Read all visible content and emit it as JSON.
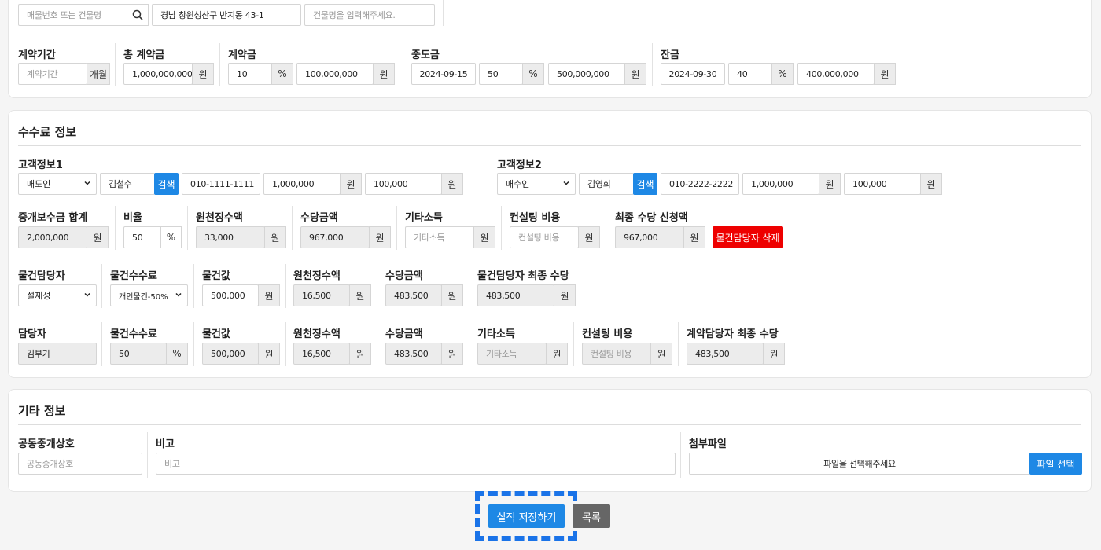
{
  "top": {
    "search_placeholder": "매물번호 또는 건물명",
    "address": "경남 창원성산구 반지동 43-1",
    "building_placeholder": "건물명을 입력해주세요."
  },
  "contract": {
    "period": {
      "label": "계약기간",
      "placeholder": "계약기간",
      "suffix": "개월"
    },
    "total": {
      "label": "총 계약금",
      "value": "1,000,000,000",
      "suffix": "원"
    },
    "deposit": {
      "label": "계약금",
      "percent": "10",
      "pct_suffix": "%",
      "amount": "100,000,000",
      "suffix": "원"
    },
    "middle": {
      "label": "중도금",
      "date": "2024-09-15",
      "percent": "50",
      "pct_suffix": "%",
      "amount": "500,000,000",
      "suffix": "원"
    },
    "balance": {
      "label": "잔금",
      "date": "2024-09-30",
      "percent": "40",
      "pct_suffix": "%",
      "amount": "400,000,000",
      "suffix": "원"
    }
  },
  "fee": {
    "title": "수수료 정보",
    "customer1": {
      "label": "고객정보1",
      "type": "매도인",
      "name": "김철수",
      "search": "검색",
      "phone": "010-1111-1111",
      "amount1": "1,000,000",
      "amount2": "100,000",
      "unit": "원"
    },
    "customer2": {
      "label": "고객정보2",
      "type": "매수인",
      "name": "김영희",
      "search": "검색",
      "phone": "010-2222-2222",
      "amount1": "1,000,000",
      "amount2": "100,000",
      "unit": "원"
    },
    "summary": {
      "total_label": "중개보수금 합계",
      "total": "2,000,000",
      "ratio_label": "비율",
      "ratio": "50",
      "ratio_unit": "%",
      "tax_label": "원천징수액",
      "tax": "33,000",
      "allow_label": "수당금액",
      "allow": "967,000",
      "other_label": "기타소득",
      "other_placeholder": "기타소득",
      "consult_label": "컨설팅 비용",
      "consult_placeholder": "컨설팅 비용",
      "final_label": "최종 수당 신청액",
      "final": "967,000",
      "delete_button": "물건담당자 삭제",
      "unit": "원"
    },
    "property_mgr": {
      "mgr_label": "물건담당자",
      "mgr": "설재성",
      "fee_label": "물건수수료",
      "fee": "개인물건-50%",
      "price_label": "물건값",
      "price": "500,000",
      "tax_label": "원천징수액",
      "tax": "16,500",
      "allow_label": "수당금액",
      "allow": "483,500",
      "final_label": "물건담당자 최종 수당",
      "final": "483,500",
      "unit": "원"
    },
    "contract_mgr": {
      "mgr_label": "담당자",
      "mgr": "김부기",
      "fee_label": "물건수수료",
      "fee": "50",
      "fee_unit": "%",
      "price_label": "물건값",
      "price": "500,000",
      "tax_label": "원천징수액",
      "tax": "16,500",
      "allow_label": "수당금액",
      "allow": "483,500",
      "other_label": "기타소득",
      "other_placeholder": "기타소득",
      "consult_label": "컨설팅 비용",
      "consult_placeholder": "컨설팅 비용",
      "final_label": "계약담당자 최종 수당",
      "final": "483,500",
      "unit": "원"
    }
  },
  "etc": {
    "title": "기타 정보",
    "joint_label": "공동중개상호",
    "joint_placeholder": "공동중개상호",
    "memo_label": "비고",
    "memo_placeholder": "비고",
    "file_label": "첨부파일",
    "file_placeholder": "파일을 선택해주세요",
    "file_button": "파일 선택"
  },
  "actions": {
    "save": "실적 저장하기",
    "list": "목록"
  },
  "colors": {
    "primary": "#1e88e5",
    "danger": "#ee0000",
    "focus": "#1a73e8",
    "dark_button": "#666666"
  }
}
